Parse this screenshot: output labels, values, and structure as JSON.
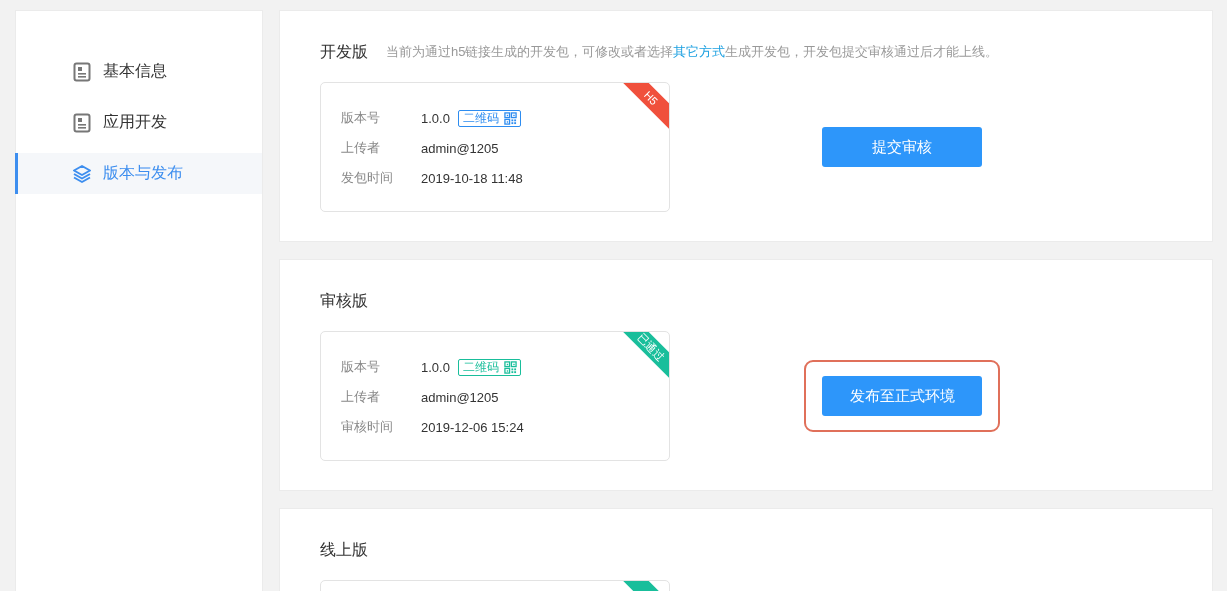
{
  "sidebar": {
    "items": [
      {
        "label": "基本信息",
        "kind": "document",
        "selected": false
      },
      {
        "label": "应用开发",
        "kind": "document",
        "selected": false
      },
      {
        "label": "版本与发布",
        "kind": "layers",
        "selected": true
      }
    ]
  },
  "sections": [
    {
      "title": "开发版",
      "note": {
        "text_before": "当前为通过h5链接生成的开发包，可修改或者选择",
        "link": "其它方式",
        "text_after": "生成开发包，开发包提交审核通过后才能上线。"
      },
      "card": {
        "ribbon": {
          "label": "H5",
          "color": "#f0503c"
        },
        "rows": [
          {
            "label": "版本号",
            "value": "1.0.0",
            "badge": {
              "label": "二维码",
              "color": "#2d8cf0"
            }
          },
          {
            "label": "上传者",
            "value": "admin@1205"
          },
          {
            "label": "发包时间",
            "value": "2019-10-18 11:48"
          }
        ]
      },
      "action": {
        "label": "提交审核",
        "highlighted": false
      }
    },
    {
      "title": "审核版",
      "card": {
        "ribbon": {
          "label": "已通过",
          "color": "#19be9b"
        },
        "rows": [
          {
            "label": "版本号",
            "value": "1.0.0",
            "badge": {
              "label": "二维码",
              "color": "#19be9b"
            }
          },
          {
            "label": "上传者",
            "value": "admin@1205"
          },
          {
            "label": "审核时间",
            "value": "2019-12-06 15:24"
          }
        ]
      },
      "action": {
        "label": "发布至正式环境",
        "highlighted": true
      }
    },
    {
      "title": "线上版",
      "card": {
        "ribbon": {
          "color": "#19be9b"
        }
      }
    }
  ]
}
